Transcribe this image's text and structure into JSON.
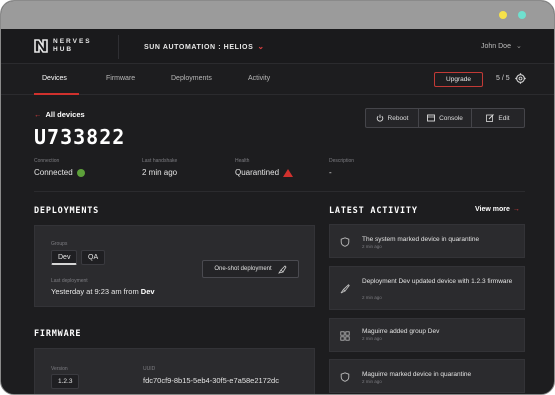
{
  "brand": {
    "logo_text_line1": "NERVES",
    "logo_text_line2": "HUB"
  },
  "org": {
    "name": "SUN AUTOMATION : HELIOS"
  },
  "user": {
    "name": "John Doe"
  },
  "tabs": [
    {
      "label": "Devices",
      "active": true
    },
    {
      "label": "Firmware",
      "active": false
    },
    {
      "label": "Deployments",
      "active": false
    },
    {
      "label": "Activity",
      "active": false
    }
  ],
  "upgrade_label": "Upgrade",
  "device_count": "5 / 5",
  "back_label": "All devices",
  "device": {
    "identifier": "U733822",
    "actions": [
      "Reboot",
      "Console",
      "Edit"
    ],
    "meta": {
      "connection_label": "Connection",
      "connection_value": "Connected",
      "handshake_label": "Last handshake",
      "handshake_value": "2 min ago",
      "health_label": "Health",
      "health_value": "Quarantined",
      "description_label": "Description",
      "description_value": "-"
    }
  },
  "deployments": {
    "title": "DEPLOYMENTS",
    "groups_label": "Groups",
    "groups": [
      "Dev",
      "QA"
    ],
    "last_label": "Last deployment",
    "last_prefix": "Yesterday at 9:23 am from",
    "last_group": "Dev",
    "oneshot_label": "One-shot deployment"
  },
  "firmware": {
    "title": "FIRMWARE",
    "version_label": "Version",
    "version": "1.2.3",
    "uuid_label": "UUID",
    "uuid": "fdc70cf9-8b15-5eb4-30f5-e7a58e2172dc"
  },
  "activity": {
    "title": "LATEST ACTIVITY",
    "view_more": "View more",
    "items": [
      {
        "icon": "shield-icon",
        "text": "The system marked device in quarantine",
        "time": "2 min ago"
      },
      {
        "icon": "rocket-icon",
        "text": "Deployment Dev updated device with 1.2.3 firmware",
        "time": "2 min ago"
      },
      {
        "icon": "group-icon",
        "text": "Maguirre added group Dev",
        "time": "2 min ago"
      },
      {
        "icon": "shield-icon",
        "text": "Maguirre marked device in quarantine",
        "time": "2 min ago"
      }
    ]
  },
  "colors": {
    "accent": "#d0312d",
    "ok": "#5da03a",
    "bg": "#1d1d1f",
    "card": "#2b2b2e"
  }
}
